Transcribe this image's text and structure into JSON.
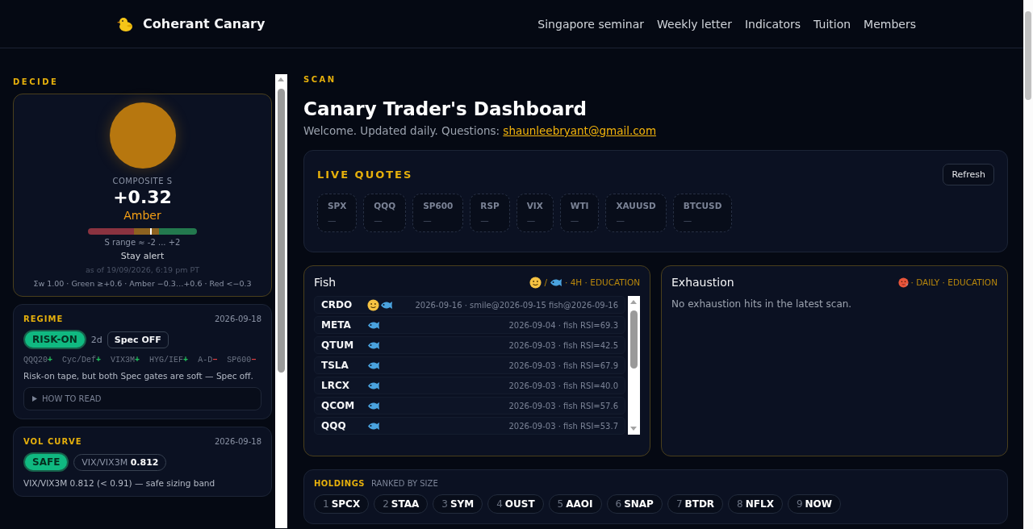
{
  "header": {
    "brand": "Coherant Canary",
    "nav": [
      "Singapore seminar",
      "Weekly letter",
      "Indicators",
      "Tuition",
      "Members"
    ]
  },
  "decide": {
    "section_label": "DECIDE",
    "composite": {
      "label": "COMPOSITE S",
      "value": "+0.32",
      "color": "#b7770f",
      "status_label": "Amber",
      "level": 0.58,
      "range": "S range ≈ -2 ... +2",
      "advice": "Stay alert",
      "as_of": "as of 19/09/2026, 6:19 pm PT",
      "legend": "Σw 1.00 · Green ≥+0.6 · Amber −0.3…+0.6 · Red <−0.3"
    },
    "regime": {
      "title": "REGIME",
      "date": "2026-09-18",
      "badge": "RISK-ON",
      "duration": "2d",
      "spec": "Spec OFF",
      "signals": [
        {
          "label": "QQQ20",
          "sign": "+",
          "positive": true
        },
        {
          "label": "Cyc/Def",
          "sign": "+",
          "positive": true
        },
        {
          "label": "VIX3M",
          "sign": "+",
          "positive": true
        },
        {
          "label": "HYG/IEF",
          "sign": "+",
          "positive": true
        },
        {
          "label": "A-D",
          "sign": "−",
          "positive": false
        },
        {
          "label": "SP600",
          "sign": "−",
          "positive": false
        }
      ],
      "note": "Risk-on tape, but both Spec gates are soft — Spec off.",
      "how_to": "HOW TO READ"
    },
    "vol_curve": {
      "title": "VOL CURVE",
      "date": "2026-09-18",
      "badge": "SAFE",
      "ratio_label": "VIX/VIX3M",
      "ratio_value": "0.812",
      "note": "VIX/VIX3M 0.812 (< 0.91) — safe sizing band"
    }
  },
  "scan": {
    "section_label": "SCAN",
    "title": "Canary Trader's Dashboard",
    "welcome": "Welcome. Updated daily. Questions:",
    "email": "shaunleebryant@gmail.com"
  },
  "live_quotes": {
    "title": "LIVE QUOTES",
    "refresh": "Refresh",
    "quotes": [
      {
        "symbol": "SPX",
        "value": "—"
      },
      {
        "symbol": "QQQ",
        "value": "—"
      },
      {
        "symbol": "SP600",
        "value": "—"
      },
      {
        "symbol": "RSP",
        "value": "—"
      },
      {
        "symbol": "VIX",
        "value": "—"
      },
      {
        "symbol": "WTI",
        "value": "—"
      },
      {
        "symbol": "XAUUSD",
        "value": "—"
      },
      {
        "symbol": "BTCUSD",
        "value": "—"
      }
    ]
  },
  "fish": {
    "title": "Fish",
    "separator": "/",
    "meta": "· 4H · EDUCATION",
    "rows": [
      {
        "ticker": "CRDO",
        "smile": true,
        "fish": true,
        "detail": "2026-09-16 · smile@2026-09-15 fish@2026-09-16"
      },
      {
        "ticker": "META",
        "smile": false,
        "fish": true,
        "detail": "2026-09-04 · fish RSI=69.3"
      },
      {
        "ticker": "QTUM",
        "smile": false,
        "fish": true,
        "detail": "2026-09-03 · fish RSI=42.5"
      },
      {
        "ticker": "TSLA",
        "smile": false,
        "fish": true,
        "detail": "2026-09-03 · fish RSI=67.9"
      },
      {
        "ticker": "LRCX",
        "smile": false,
        "fish": true,
        "detail": "2026-09-03 · fish RSI=40.0"
      },
      {
        "ticker": "QCOM",
        "smile": false,
        "fish": true,
        "detail": "2026-09-03 · fish RSI=57.6"
      },
      {
        "ticker": "QQQ",
        "smile": false,
        "fish": true,
        "detail": "2026-09-03 · fish RSI=53.7"
      }
    ]
  },
  "exhaustion": {
    "title": "Exhaustion",
    "meta": "· DAILY · EDUCATION",
    "empty_note": "No exhaustion hits in the latest scan."
  },
  "holdings": {
    "title": "HOLDINGS",
    "subtitle": "RANKED BY SIZE",
    "items": [
      {
        "rank": "1",
        "ticker": "SPCX"
      },
      {
        "rank": "2",
        "ticker": "STAA"
      },
      {
        "rank": "3",
        "ticker": "SYM"
      },
      {
        "rank": "4",
        "ticker": "OUST"
      },
      {
        "rank": "5",
        "ticker": "AAOI"
      },
      {
        "rank": "6",
        "ticker": "SNAP"
      },
      {
        "rank": "7",
        "ticker": "BTDR"
      },
      {
        "rank": "8",
        "ticker": "NFLX"
      },
      {
        "rank": "9",
        "ticker": "NOW"
      }
    ]
  }
}
